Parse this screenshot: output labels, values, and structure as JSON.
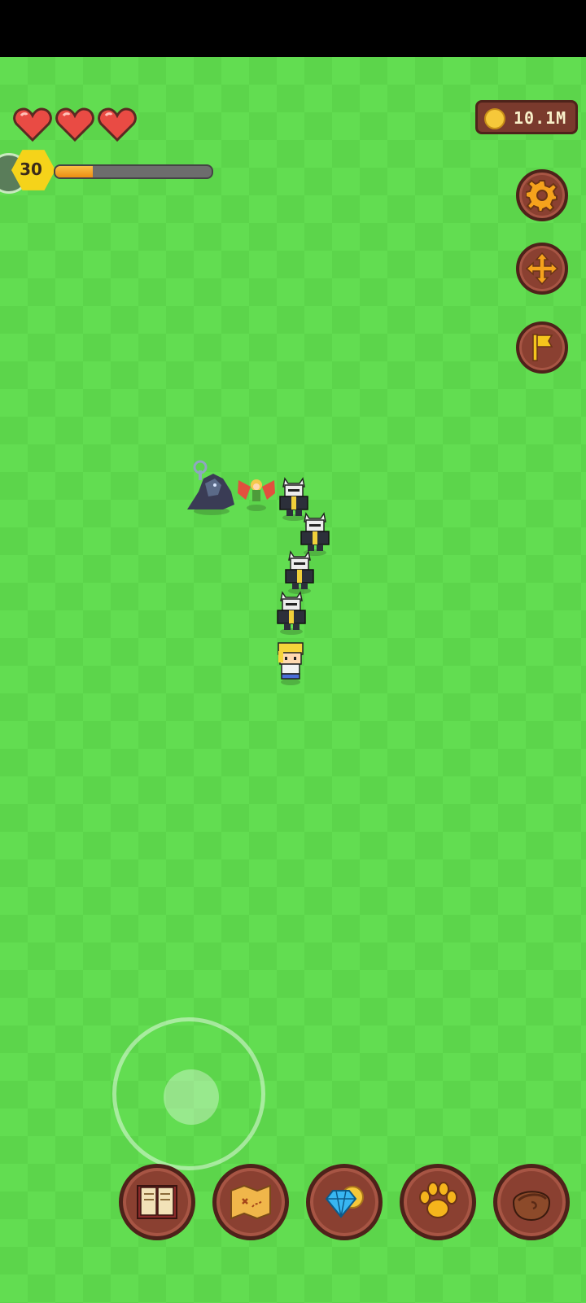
{
  "hud": {
    "hearts": [
      {
        "icon": "heart-icon",
        "full": true
      },
      {
        "icon": "heart-icon",
        "full": true
      },
      {
        "icon": "heart-icon",
        "full": true
      }
    ],
    "level": "30",
    "xp_progress": 0.24,
    "coins": "10.1M",
    "colors": {
      "grass_light": "#62dd51",
      "grass_dark": "#5cd54b",
      "button_brown": "#8a4031",
      "level_yellow": "#f5d31a",
      "xp_orange": "#ed8d13"
    }
  },
  "side_buttons": [
    {
      "name": "settings-button",
      "icon": "gear-icon"
    },
    {
      "name": "move-button",
      "icon": "move-arrows-icon"
    },
    {
      "name": "flag-button",
      "icon": "flag-icon"
    }
  ],
  "dock_buttons": [
    {
      "name": "book-button",
      "icon": "book-icon"
    },
    {
      "name": "map-button",
      "icon": "map-scroll-icon"
    },
    {
      "name": "shop-button",
      "icon": "gem-coin-icon"
    },
    {
      "name": "pets-button",
      "icon": "paw-icon"
    },
    {
      "name": "inventory-button",
      "icon": "leather-bag-icon"
    }
  ],
  "characters": [
    {
      "name": "hero",
      "icon": "hero-sprite"
    },
    {
      "name": "knight",
      "icon": "armored-knight-sprite"
    },
    {
      "name": "knight",
      "icon": "armored-knight-sprite"
    },
    {
      "name": "knight",
      "icon": "armored-knight-sprite"
    },
    {
      "name": "knight",
      "icon": "armored-knight-sprite"
    },
    {
      "name": "fairy",
      "icon": "fairy-sprite"
    },
    {
      "name": "shadow-beast",
      "icon": "dark-beast-sprite"
    }
  ]
}
